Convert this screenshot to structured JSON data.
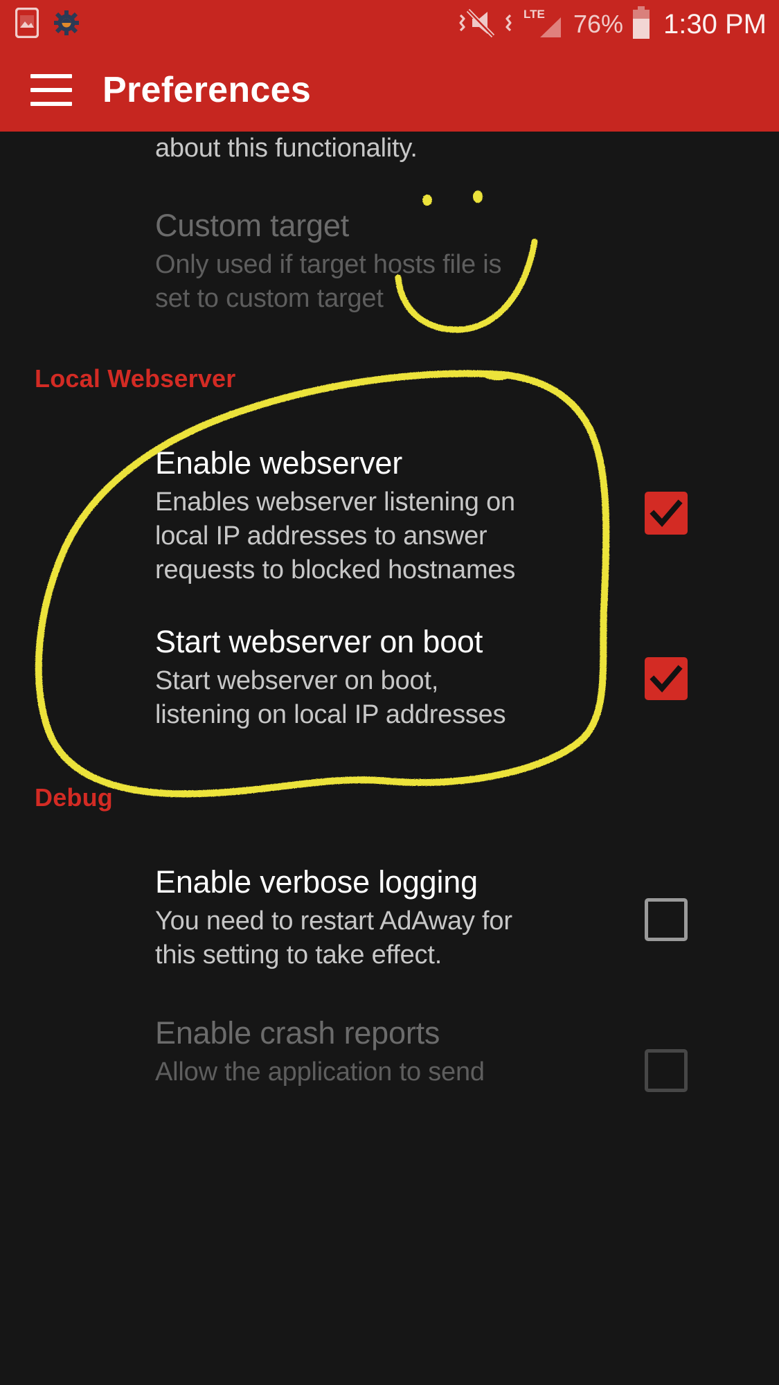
{
  "statusbar": {
    "icons_left": [
      "screenshot-image-icon",
      "gear-icon"
    ],
    "icons_right": [
      "vibrate-mute-icon",
      "lte-signal-icon",
      "battery-icon"
    ],
    "lte_label": "LTE",
    "battery_percent": "76%",
    "time": "1:30 PM"
  },
  "appbar": {
    "menu_icon": "hamburger-menu-icon",
    "title": "Preferences",
    "background_color": "#C62620"
  },
  "colors": {
    "accent_red": "#D32B24",
    "appbar_red": "#C62620",
    "background": "#161616",
    "annotation_yellow": "#ECE33A",
    "text_primary": "#FFFFFF",
    "text_secondary": "#C7C7C7",
    "text_disabled": "#6B6B6B"
  },
  "content": {
    "clipped_top_text": "about this functionality.",
    "items": [
      {
        "name": "custom-target",
        "title": "Custom target",
        "subtitle": "Only used if target hosts file is set to custom target",
        "enabled": false,
        "has_checkbox": false
      },
      {
        "name": "enable-webserver",
        "title": "Enable webserver",
        "subtitle": "Enables webserver listening on local IP addresses to answer requests to blocked hostnames",
        "enabled": true,
        "has_checkbox": true,
        "checked": true
      },
      {
        "name": "start-webserver-on-boot",
        "title": "Start webserver on boot",
        "subtitle": "Start webserver on boot, listening on local IP addresses",
        "enabled": true,
        "has_checkbox": true,
        "checked": true
      },
      {
        "name": "enable-verbose-logging",
        "title": "Enable verbose logging",
        "subtitle": "You need to restart AdAway for this setting to take effect.",
        "enabled": true,
        "has_checkbox": true,
        "checked": false
      },
      {
        "name": "enable-crash-reports",
        "title": "Enable crash reports",
        "subtitle": "Allow the application to send",
        "enabled": false,
        "has_checkbox": true,
        "checked": false
      }
    ],
    "categories": [
      {
        "name": "local-webserver",
        "label": "Local Webserver"
      },
      {
        "name": "debug",
        "label": "Debug"
      }
    ]
  },
  "annotation": {
    "type": "handwritten-yellow-ink",
    "color": "#ECE33A",
    "shapes": [
      "smiley-face",
      "circle-highlight"
    ],
    "circles_items": [
      "enable-webserver",
      "start-webserver-on-boot"
    ]
  }
}
